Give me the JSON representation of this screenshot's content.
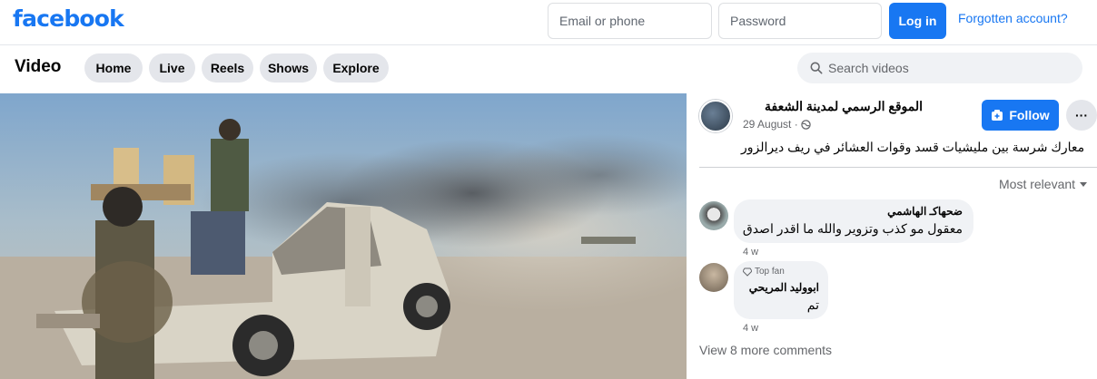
{
  "header": {
    "logo": "facebook",
    "email_placeholder": "Email or phone",
    "password_placeholder": "Password",
    "login_label": "Log in",
    "forgot_label": "Forgotten account?"
  },
  "nav": {
    "title": "Video",
    "tabs": [
      "Home",
      "Live",
      "Reels",
      "Shows",
      "Explore"
    ],
    "search_placeholder": "Search videos"
  },
  "post": {
    "page_name": "الموقع الرسمي لمدينة الشعفة",
    "date": "29 August ·",
    "follow_label": "Follow",
    "more_label": "···",
    "text": "معارك شرسة بين مليشيات قسد وقوات العشائر في ريف ديرالزور",
    "sort_label": "Most relevant"
  },
  "comments": [
    {
      "name": "ضحهاكـ الهاشمي",
      "text": "معقول مو كذب وتزوير والله ما اقدر اصدق",
      "time": "4 w"
    },
    {
      "badge": "Top fan",
      "name": "ابووليد المريحي",
      "text": "تم",
      "time": "4 w"
    }
  ],
  "view_more": "View 8 more comments",
  "colors": {
    "brand": "#1877f2",
    "tab_bg": "#e4e6eb",
    "bubble_bg": "#f0f2f5"
  },
  "icons": {
    "search": "search-icon",
    "globe": "globe-icon",
    "follow": "follow-page-icon",
    "caret": "caret-down-icon",
    "top_fan": "diamond-icon"
  }
}
